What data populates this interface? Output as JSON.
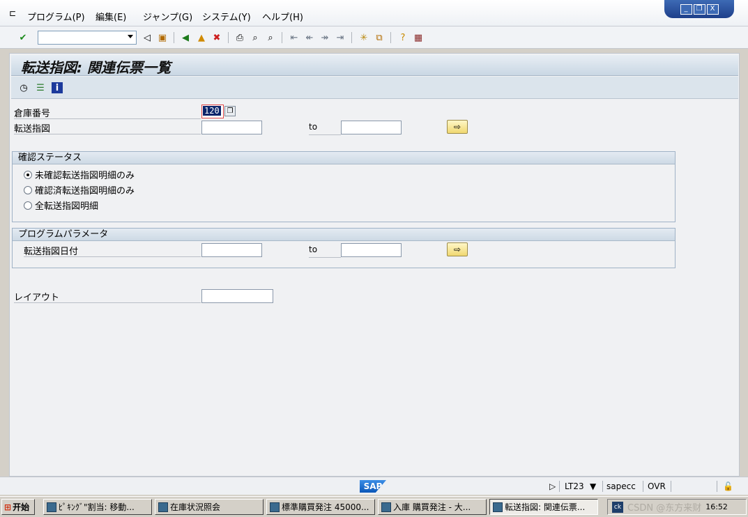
{
  "menu": {
    "items": [
      "プログラム(P)",
      "編集(E)",
      "ジャンプ(G)",
      "システム(Y)",
      "ヘルプ(H)"
    ]
  },
  "window_controls": [
    "_",
    "❐",
    "X"
  ],
  "toolbar": {
    "command_field_value": "",
    "icons": [
      "check-icon",
      "back-triangle-icon",
      "save-icon",
      "back-icon",
      "exit-icon",
      "cancel-icon",
      "print-icon",
      "find-icon",
      "find-next-icon",
      "first-page-icon",
      "prev-page-icon",
      "next-page-icon",
      "last-page-icon",
      "new-session-icon",
      "shortcut-icon",
      "help-icon",
      "layout-icon"
    ]
  },
  "screen": {
    "title": "転送指図: 関連伝票一覧",
    "app_icons": [
      "execute-icon",
      "selection-options-icon",
      "info-icon"
    ]
  },
  "form": {
    "warehouse_label": "倉庫番号",
    "warehouse_value": "120",
    "transfer_order_label": "転送指図",
    "transfer_order_from": "",
    "to_label": "to",
    "transfer_order_to": ""
  },
  "confirm_status": {
    "header": "確認ステータス",
    "options": [
      {
        "label": "未確認転送指図明細のみ",
        "selected": true
      },
      {
        "label": "確認済転送指図明細のみ",
        "selected": false
      },
      {
        "label": "全転送指図明細",
        "selected": false
      }
    ]
  },
  "program_params": {
    "header": "プログラムパラメータ",
    "date_label": "転送指図日付",
    "date_from": "",
    "to_label": "to",
    "date_to": ""
  },
  "layout": {
    "label": "レイアウト",
    "value": ""
  },
  "statusbar": {
    "logo": "SAP",
    "transaction": "LT23",
    "server": "sapecc",
    "mode": "OVR"
  },
  "taskbar": {
    "start": "开始",
    "tasks": [
      "ﾋﾟｷﾝｸﾞ\"割当: 移動...",
      "在庫状況照会",
      "標準購買発注 45000...",
      "入庫 購買発注 - 大...",
      "転送指図: 関連伝票..."
    ],
    "tray_time": "16:52",
    "watermark": "CSDN @东方来财"
  }
}
